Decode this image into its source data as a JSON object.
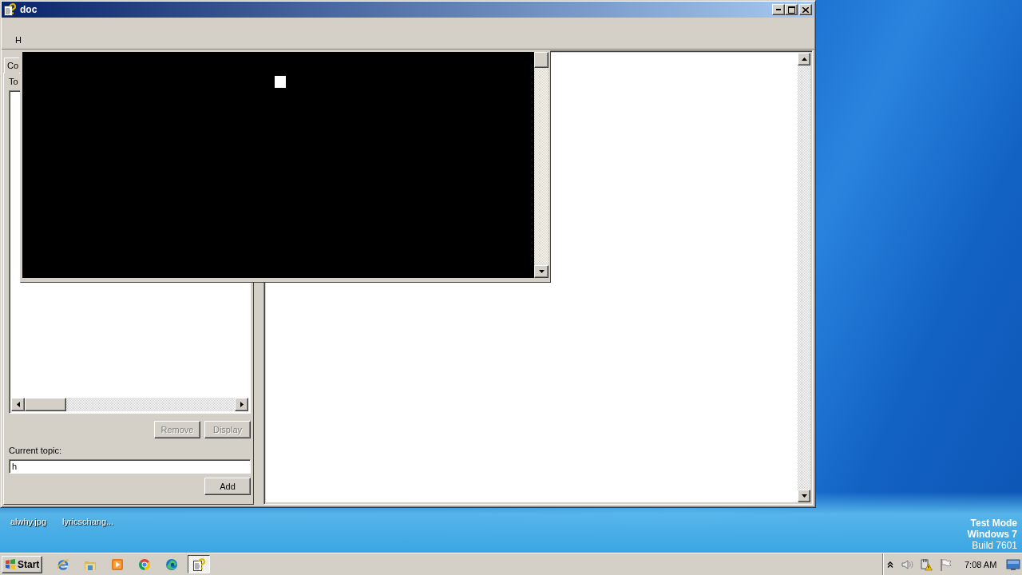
{
  "window": {
    "title": "doc"
  },
  "menu": {
    "items": [
      "H"
    ]
  },
  "tabs": [
    {
      "label": "Co",
      "selected": true
    }
  ],
  "topics_panel": {
    "label": "To",
    "buttons": [
      {
        "label": "Remove",
        "disabled": true
      },
      {
        "label": "Display",
        "disabled": true
      }
    ],
    "current_topic": {
      "label": "Current topic:",
      "value": "h"
    },
    "add_button": {
      "label": "Add",
      "disabled": false
    }
  },
  "desktop": {
    "icons": [
      {
        "label": "alwhy.jpg"
      },
      {
        "label": "lyricschang..."
      }
    ],
    "notice": [
      {
        "text": "Test Mode",
        "bold": true
      },
      {
        "text": "Windows 7",
        "bold": true
      },
      {
        "text": "Build 7601",
        "bold": false
      }
    ]
  },
  "taskbar": {
    "start": "Start",
    "tasks": [
      {
        "selected": true
      }
    ],
    "clock": "7:08 AM"
  }
}
